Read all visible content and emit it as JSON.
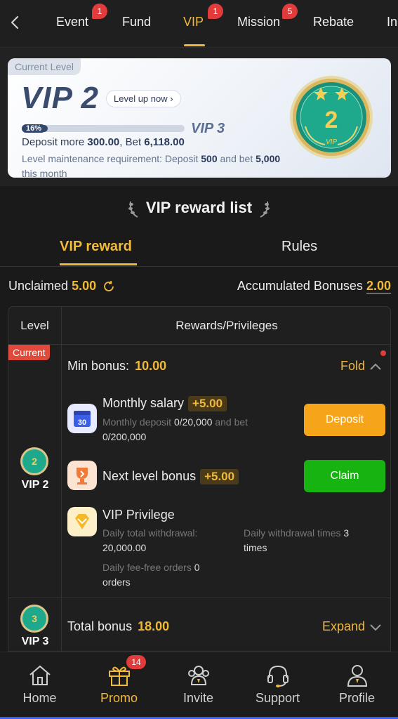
{
  "top_tabs": [
    {
      "label": "Event",
      "badge": "1"
    },
    {
      "label": "Fund",
      "badge": ""
    },
    {
      "label": "VIP",
      "badge": "1"
    },
    {
      "label": "Mission",
      "badge": "5"
    },
    {
      "label": "Rebate",
      "badge": ""
    },
    {
      "label": "In",
      "badge": ""
    }
  ],
  "active_tab": "VIP",
  "vip_card": {
    "current_level_label": "Current Level",
    "current_vip": "VIP 2",
    "level_up_label": "Level up now",
    "progress_label": "16%",
    "progress_fraction": 0.16,
    "next_vip": "VIP 3",
    "deposit_prefix": "Deposit more",
    "deposit_amount": "300.00",
    "bet_prefix": ", Bet",
    "bet_amount": "6,118.00",
    "maint_prefix": "Level maintenance requirement: Deposit",
    "maint_deposit": "500",
    "maint_mid": "and bet",
    "maint_bet": "5,000",
    "maint_suffix": "this month",
    "medal_number": "2",
    "medal_text": "VIP"
  },
  "reward_list_title": "VIP reward list",
  "sub_tabs": {
    "reward": "VIP reward",
    "rules": "Rules"
  },
  "summary": {
    "unclaimed_label": "Unclaimed",
    "unclaimed_value": "5.00",
    "accumulated_label": "Accumulated Bonuses",
    "accumulated_value": "2.00"
  },
  "table": {
    "header_level": "Level",
    "header_rewards": "Rewards/Privileges",
    "current_tag": "Current",
    "row1": {
      "level": "VIP 2",
      "level_medal_number": "2",
      "min_bonus_label": "Min bonus:",
      "min_bonus_value": "10.00",
      "fold_label": "Fold",
      "monthly_salary": {
        "title": "Monthly salary",
        "amount": "+5.00",
        "icon_day": "30",
        "sub_prefix": "Monthly deposit",
        "sub_deposit": "0/20,000",
        "sub_mid": "and bet",
        "sub_bet": "0/200,000",
        "button": "Deposit"
      },
      "next_level_bonus": {
        "title": "Next level bonus",
        "amount": "+5.00",
        "button": "Claim"
      },
      "vip_privilege": {
        "title": "VIP Privilege",
        "withdrawal_label": "Daily total withdrawal:",
        "withdrawal_value": "20,000.00",
        "times_label": "Daily withdrawal times",
        "times_value": "3",
        "times_suffix": "times",
        "fee_free_label": "Daily fee-free orders",
        "fee_free_value": "0",
        "fee_free_suffix": "orders"
      }
    },
    "row2": {
      "level": "VIP 3",
      "level_medal_number": "3",
      "total_bonus_label": "Total bonus",
      "total_bonus_value": "18.00",
      "expand_label": "Expand"
    }
  },
  "bottom_nav": [
    {
      "label": "Home",
      "icon": "home-icon",
      "badge": ""
    },
    {
      "label": "Promo",
      "icon": "gift-icon",
      "badge": "14"
    },
    {
      "label": "Invite",
      "icon": "invite-icon",
      "badge": ""
    },
    {
      "label": "Support",
      "icon": "headset-icon",
      "badge": ""
    },
    {
      "label": "Profile",
      "icon": "profile-icon",
      "badge": ""
    }
  ],
  "colors": {
    "accent": "#f0b93a",
    "deposit_button": "#f6a51b",
    "claim_button": "#17b411",
    "badge": "#e23b3b"
  }
}
